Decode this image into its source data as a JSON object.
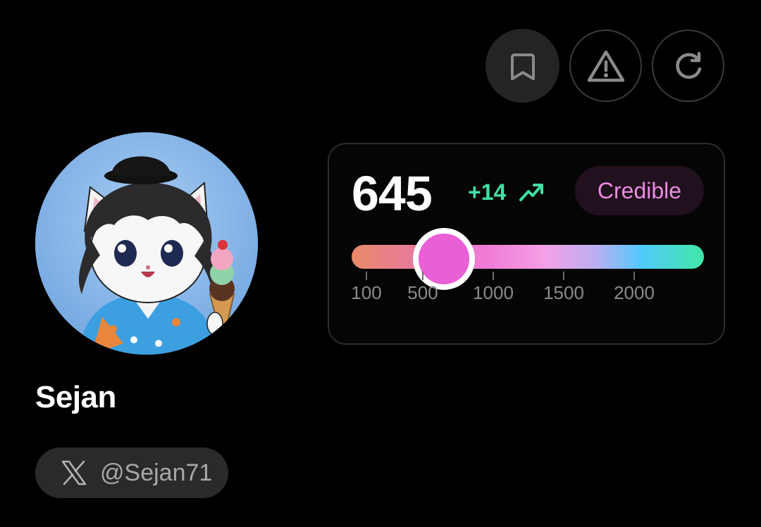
{
  "actions": {
    "items": [
      {
        "icon": "bookmark-icon"
      },
      {
        "icon": "warning-icon"
      },
      {
        "icon": "refresh-icon"
      }
    ]
  },
  "profile": {
    "name": "Sejan",
    "handle": "@Sejan71",
    "handle_icon": "x-logo-icon",
    "avatar_icon": "cat-avatar-image"
  },
  "score": {
    "value": "645",
    "delta": "+14",
    "trend_icon": "trending-up-icon",
    "status": "Credible",
    "scale": {
      "ticks": [
        "100",
        "500",
        "1000",
        "1500",
        "2000"
      ],
      "current": 645
    }
  },
  "colors": {
    "background": "#000000",
    "accent_green": "#3fe0a4",
    "badge_text": "#e98be0",
    "thumb": "#e85fd6"
  }
}
